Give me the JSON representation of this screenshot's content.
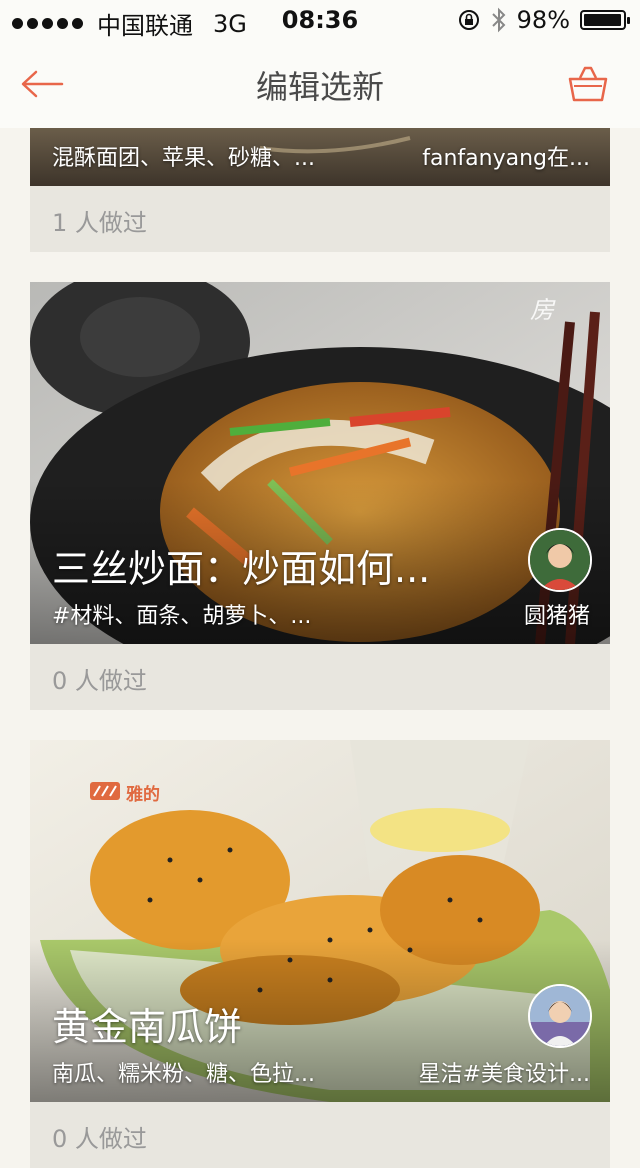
{
  "status_bar": {
    "carrier": "中国联通",
    "network": "3G",
    "time": "08:36",
    "battery": "98%",
    "battery_level": 0.98
  },
  "nav": {
    "title": "编辑选新",
    "back_icon": "arrow-left-icon",
    "cart_icon": "basket-icon",
    "accent_color": "#e8664a"
  },
  "recipes": [
    {
      "title": "",
      "ingredients": "混酥面团、苹果、砂糖、...",
      "author": "fanfanyang在...",
      "made_count": "1 人做过"
    },
    {
      "title": "三丝炒面：炒面如何...",
      "ingredients": "#材料、面条、胡萝卜、...",
      "author": "圆猪猪",
      "made_count": "0 人做过",
      "watermark": "房"
    },
    {
      "title": "黄金南瓜饼",
      "ingredients": "南瓜、糯米粉、糖、色拉...",
      "author": "星洁#美食设计...",
      "made_count": "0 人做过",
      "logo_text": "雅的"
    }
  ]
}
